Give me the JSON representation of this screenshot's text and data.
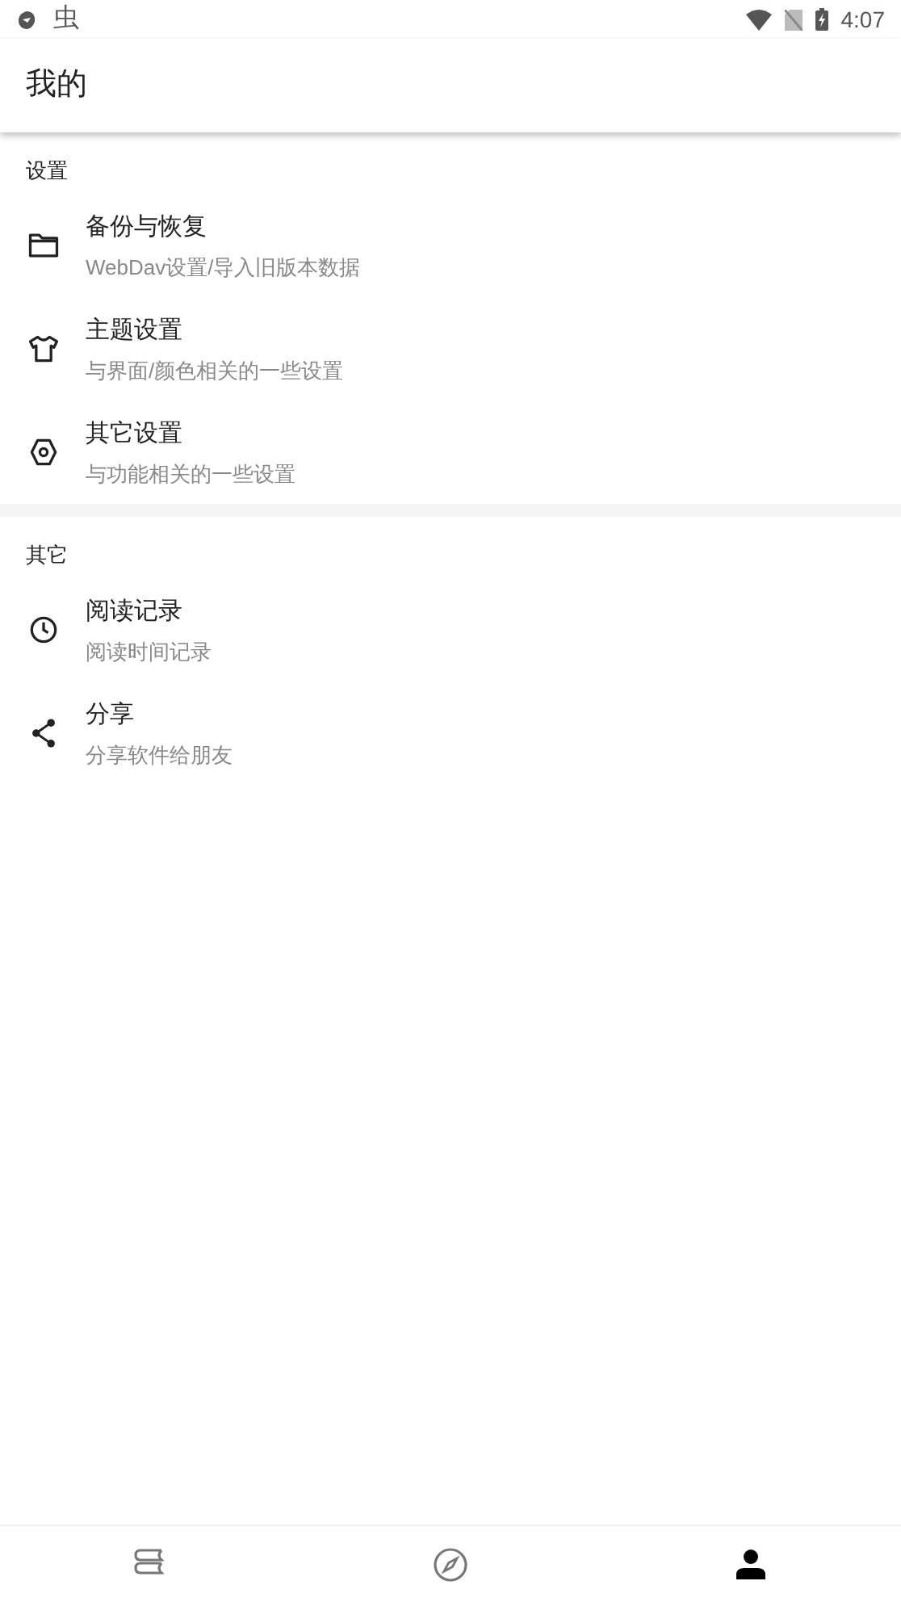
{
  "status_bar": {
    "notification": "虫",
    "time": "4:07"
  },
  "app_bar": {
    "title": "我的"
  },
  "sections": [
    {
      "title": "设置",
      "items": [
        {
          "title": "备份与恢复",
          "subtitle": "WebDav设置/导入旧版本数据"
        },
        {
          "title": "主题设置",
          "subtitle": "与界面/颜色相关的一些设置"
        },
        {
          "title": "其它设置",
          "subtitle": "与功能相关的一些设置"
        }
      ]
    },
    {
      "title": "其它",
      "items": [
        {
          "title": "阅读记录",
          "subtitle": "阅读时间记录"
        },
        {
          "title": "分享",
          "subtitle": "分享软件给朋友"
        }
      ]
    }
  ],
  "bottom_nav": [
    {
      "selected": false
    },
    {
      "selected": false
    },
    {
      "selected": true
    }
  ]
}
